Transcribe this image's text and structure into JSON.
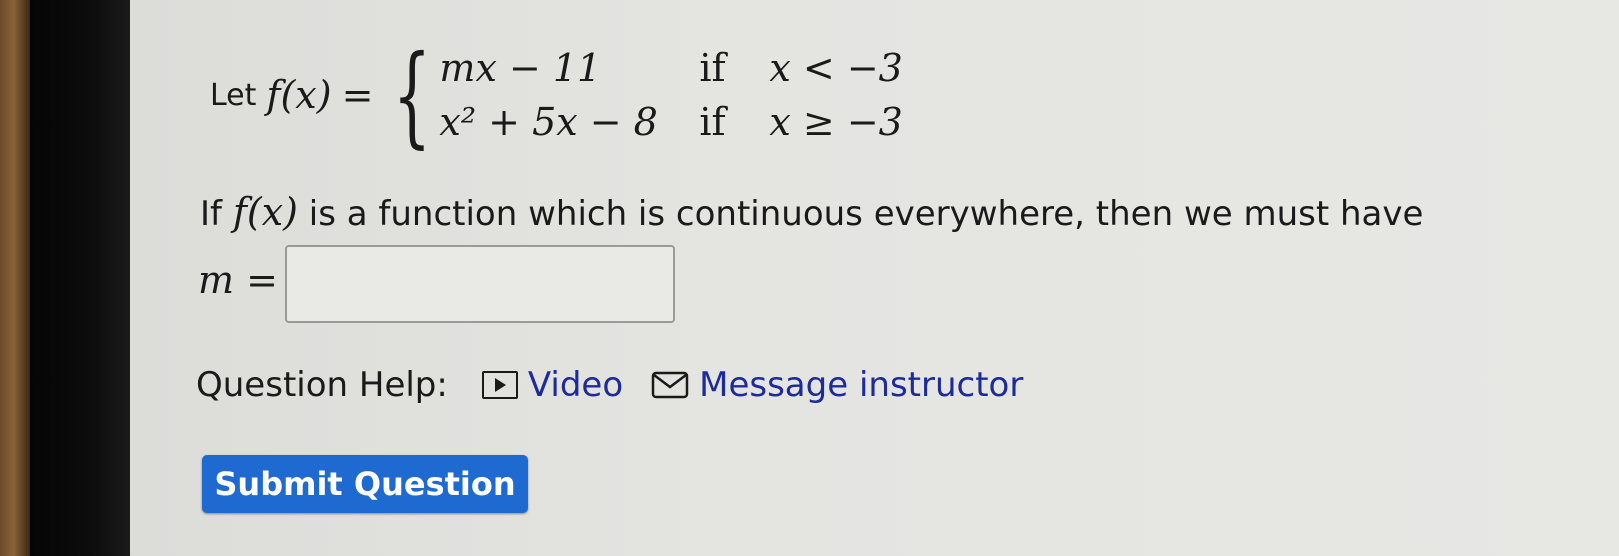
{
  "problem": {
    "let_word": "Let",
    "fx": "f(x)",
    "equals": "=",
    "brace": "{",
    "cases": [
      {
        "expr": "mx − 11",
        "cond_word": "if",
        "cond": "x < −3"
      },
      {
        "expr": "x² + 5x − 8",
        "cond_word": "if",
        "cond": "x ≥ −3"
      }
    ]
  },
  "question": {
    "part1": "If ",
    "fx": "f(x)",
    "part2": " is a function which is continuous everywhere, then we must have"
  },
  "answer": {
    "label": "m =",
    "value": ""
  },
  "help": {
    "label": "Question Help:",
    "video_label": "Video",
    "message_label": "Message instructor",
    "link_color": "#1d2b9a"
  },
  "submit": {
    "label": "Submit Question",
    "color": "#1e6ad0"
  }
}
